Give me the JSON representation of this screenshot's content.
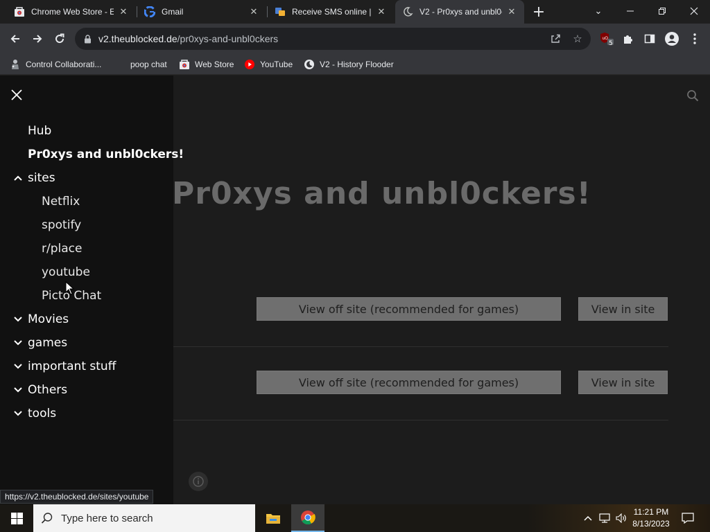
{
  "browser": {
    "tabs": [
      {
        "title": "Chrome Web Store - Ex",
        "icon": "chrome-web-store-icon"
      },
      {
        "title": "Gmail",
        "icon": "google-icon"
      },
      {
        "title": "Receive SMS online | Te",
        "icon": "sms-site-icon"
      },
      {
        "title": "V2 - Pr0xys and unbl0c",
        "icon": "moon-icon",
        "active": true
      }
    ],
    "url_host": "v2.theublocked.de",
    "url_path": "/pr0xys-and-unbl0ckers",
    "extension_badge": "5",
    "bookmarks": [
      {
        "label": "Control Collaborati...",
        "icon": "figure-icon"
      },
      {
        "label": "poop chat",
        "icon": ""
      },
      {
        "label": "Web Store",
        "icon": "web-store-icon"
      },
      {
        "label": "YouTube",
        "icon": "youtube-icon"
      },
      {
        "label": "V2 - History Flooder",
        "icon": "moon-circle-icon"
      }
    ]
  },
  "sidebar": {
    "items": [
      {
        "label": "Hub"
      },
      {
        "label": "Pr0xys and unbl0ckers!"
      },
      {
        "label": "sites",
        "expanded": true
      },
      {
        "label": "Netflix"
      },
      {
        "label": "spotify"
      },
      {
        "label": "r/place"
      },
      {
        "label": "youtube"
      },
      {
        "label": "Picto Chat"
      },
      {
        "label": "Movies"
      },
      {
        "label": "games"
      },
      {
        "label": "important stuff"
      },
      {
        "label": "Others"
      },
      {
        "label": "tools"
      }
    ]
  },
  "main": {
    "heading": "Pr0xys and unbl0ckers!",
    "rows": [
      {
        "off_site_label": "View off site (recommended for games)",
        "in_site_label": "View in site"
      },
      {
        "off_site_label": "View off site (recommended for games)",
        "in_site_label": "View in site"
      }
    ]
  },
  "status_url": "https://v2.theublocked.de/sites/youtube",
  "taskbar": {
    "search_placeholder": "Type here to search",
    "time": "11:21 PM",
    "date": "8/13/2023"
  },
  "colors": {
    "sidebar_bg": "#111111",
    "page_bg": "#1c1c1c",
    "button_bg": "#6f6f6f",
    "heading": "#6a6a6a"
  }
}
